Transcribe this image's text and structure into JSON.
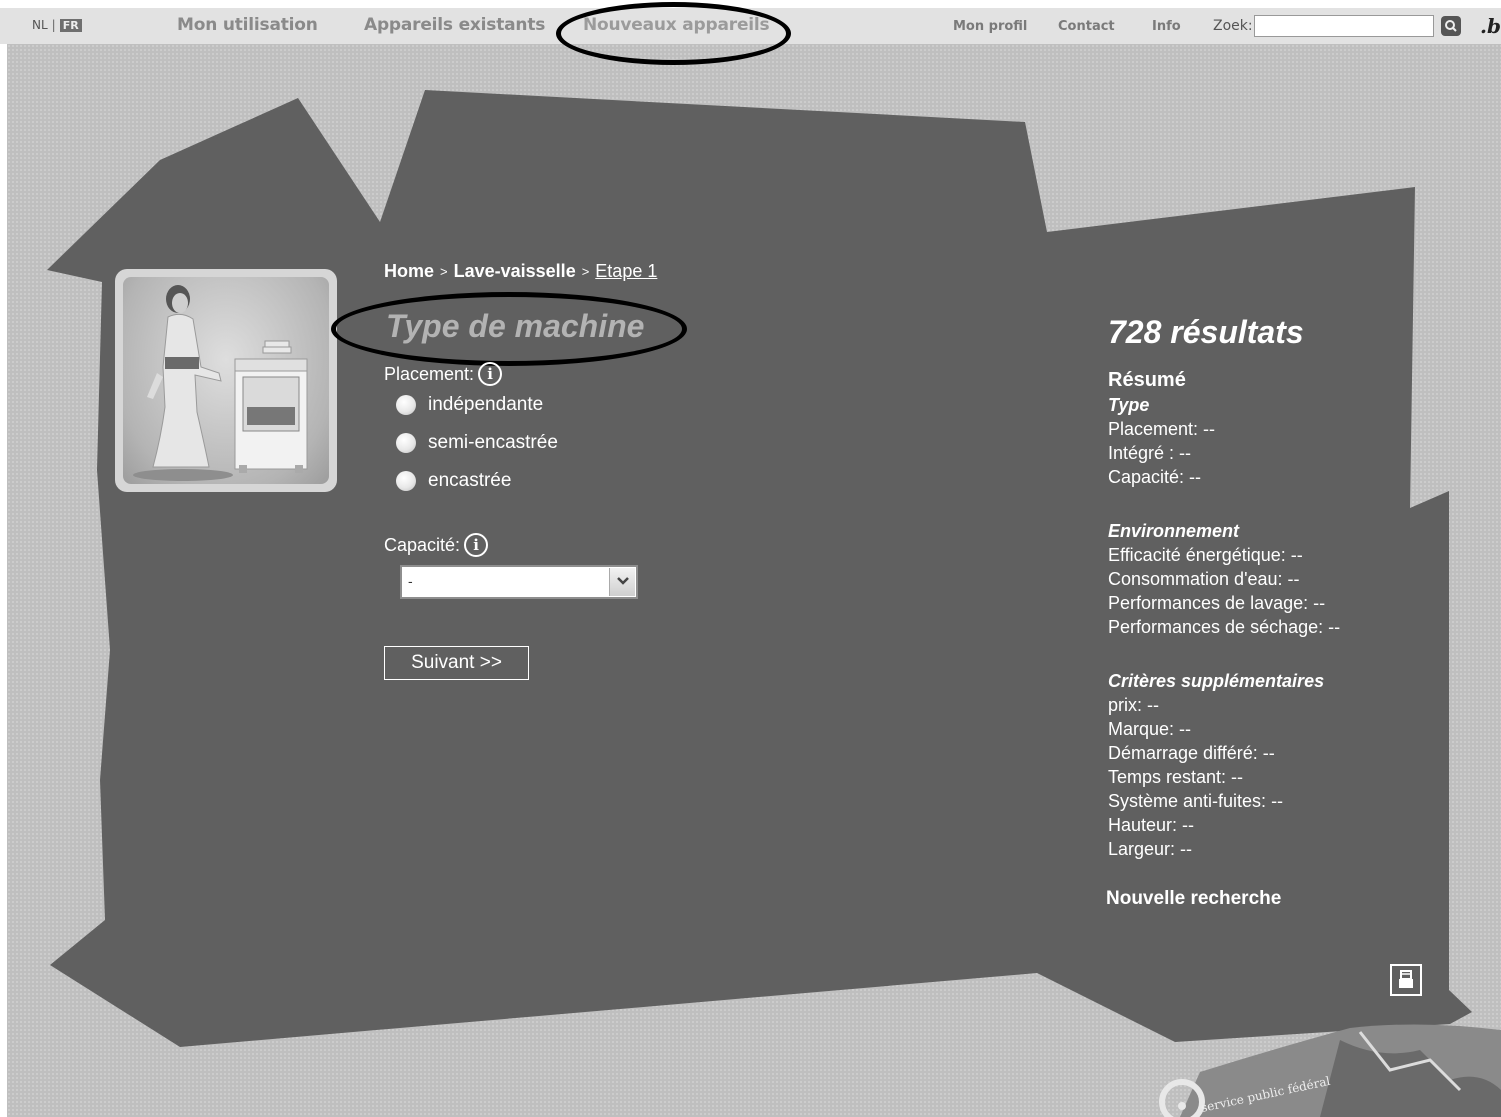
{
  "header": {
    "languages": {
      "nl": "NL",
      "sep": "|",
      "fr": "FR"
    },
    "nav": [
      "Mon utilisation",
      "Appareils existants",
      "Nouveaux appareils"
    ],
    "utility": [
      "Mon profil",
      "Contact",
      "Info"
    ],
    "search_label": "Zoek:",
    "search_value": "",
    "brand": ".be"
  },
  "breadcrumb": {
    "home": "Home",
    "sep": ">",
    "category": "Lave-vaisselle",
    "current": "Etape 1"
  },
  "form": {
    "title": "Type de machine",
    "placement_label": "Placement:",
    "placement_options": [
      "indépendante",
      "semi-encastrée",
      "encastrée"
    ],
    "capacity_label": "Capacité:",
    "capacity_selected": "-",
    "next_button": "Suivant >>"
  },
  "summary": {
    "results": "728 résultats",
    "heading": "Résumé",
    "type_title": "Type",
    "type_lines": [
      "Placement: --",
      "Intégré : --",
      "Capacité: --"
    ],
    "env_title": "Environnement",
    "env_lines": [
      "Efficacité énergétique: --",
      "Consommation d'eau: --",
      "Performances de lavage: --",
      "Performances de séchage: --"
    ],
    "extra_title": "Critères supplémentaires",
    "extra_lines": [
      "prix: --",
      "Marque: --",
      "Démarrage différé: --",
      "Temps restant: --",
      "Système anti-fuites: --",
      "Hauteur: --",
      "Largeur: --"
    ],
    "new_search": "Nouvelle recherche"
  },
  "footer_logo": "service public fédéral",
  "icons": [
    "search-icon",
    "info-icon",
    "chevron-down-icon",
    "print-icon"
  ],
  "colors": {
    "panel": "#606060",
    "page_bg": "#bfbfbf",
    "nav_bar": "#e2e2e2",
    "text": "#ffffff"
  }
}
